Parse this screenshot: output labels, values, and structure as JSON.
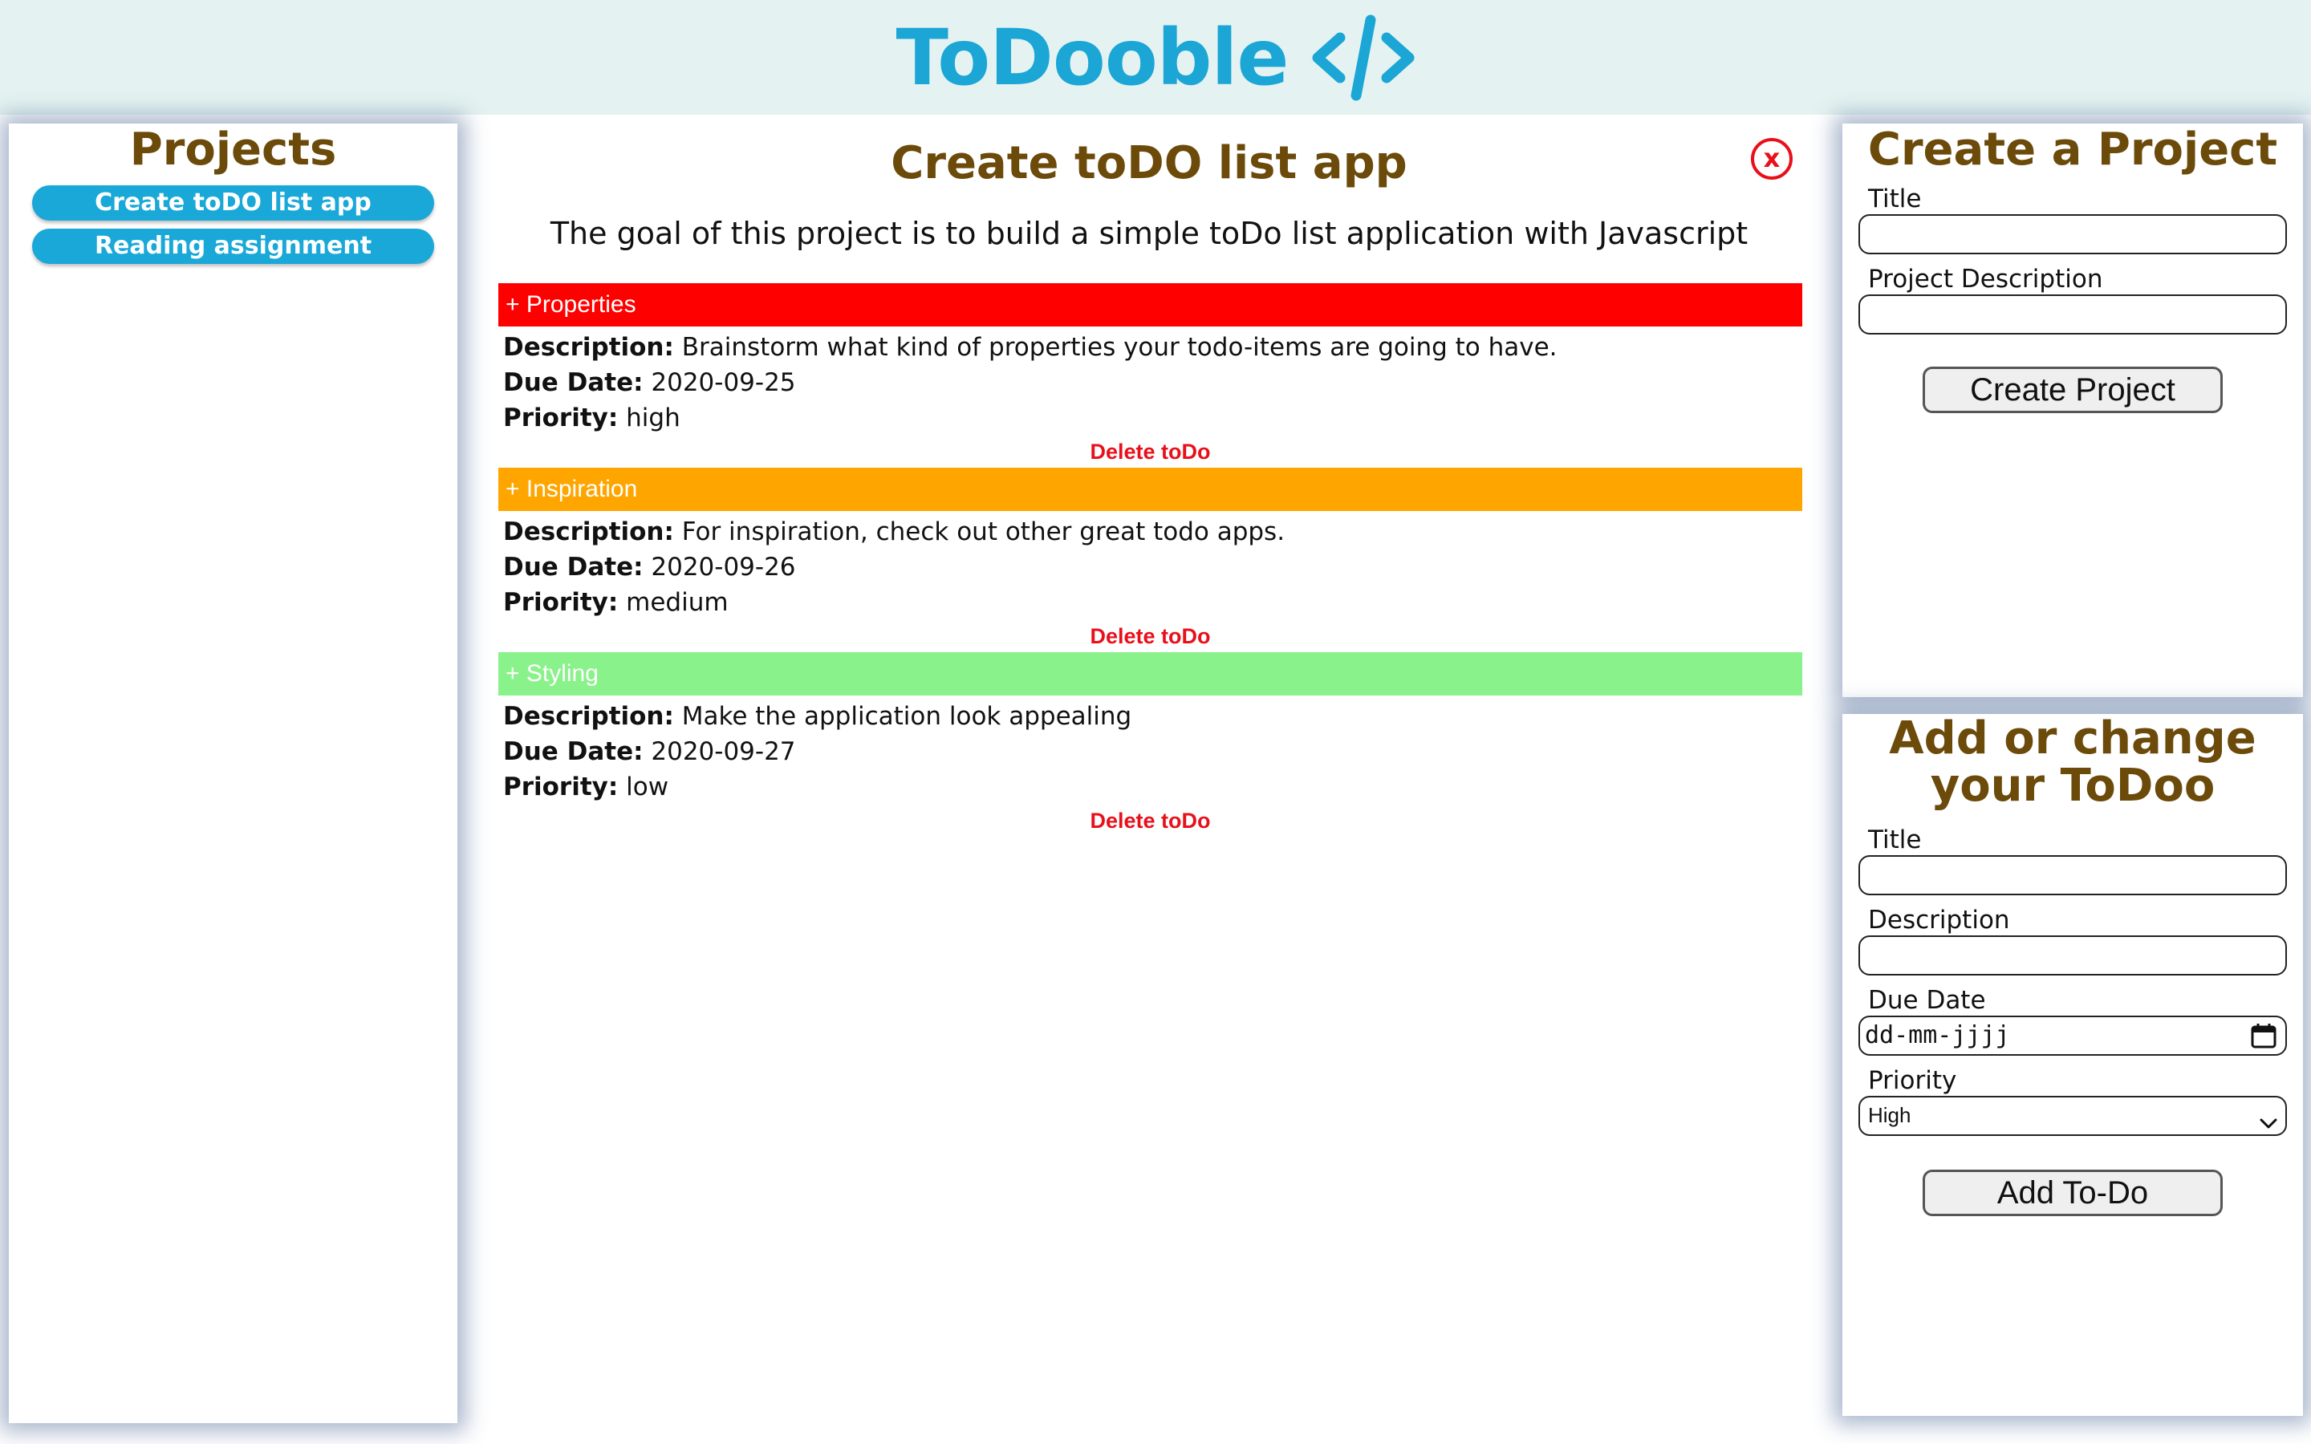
{
  "header": {
    "brand_name": "ToDooble",
    "brand_icon": "code-brackets-icon",
    "brand_color": "#1ba6d6",
    "background": "#e4f3f1"
  },
  "projects": {
    "title": "Projects",
    "items": [
      {
        "label": "Create toDO list app"
      },
      {
        "label": "Reading assignment"
      }
    ],
    "item_color": "#1aa8d8"
  },
  "main": {
    "title": "Create toDO list app",
    "close_label": "x",
    "description": "The goal of this project is to build a simple toDo list application with Javascript",
    "todos": [
      {
        "title": "+ Properties",
        "color": "#ff0000",
        "description_label": "Description:",
        "description": "Brainstorm what kind of properties your todo-items are going to have.",
        "due_label": "Due Date:",
        "due_date": "2020-09-25",
        "priority_label": "Priority:",
        "priority": "high",
        "delete_label": "Delete toDo"
      },
      {
        "title": "+ Inspiration",
        "color": "#ffa500",
        "description_label": "Description:",
        "description": "For inspiration, check out other great todo apps.",
        "due_label": "Due Date:",
        "due_date": "2020-09-26",
        "priority_label": "Priority:",
        "priority": "medium",
        "delete_label": "Delete toDo"
      },
      {
        "title": "+ Styling",
        "color": "#8af28a",
        "description_label": "Description:",
        "description": "Make the application look appealing",
        "due_label": "Due Date:",
        "due_date": "2020-09-27",
        "priority_label": "Priority:",
        "priority": "low",
        "delete_label": "Delete toDo"
      }
    ]
  },
  "create_project": {
    "title": "Create a Project",
    "title_label": "Title",
    "title_value": "",
    "description_label": "Project Description",
    "description_value": "",
    "button_label": "Create Project"
  },
  "todo_form": {
    "title": "Add or change your ToDoo",
    "title_label": "Title",
    "title_value": "",
    "description_label": "Description",
    "description_value": "",
    "due_label": "Due Date",
    "due_placeholder": "dd-mm-jjjj",
    "priority_label": "Priority",
    "priority_selected": "High",
    "button_label": "Add To-Do"
  }
}
